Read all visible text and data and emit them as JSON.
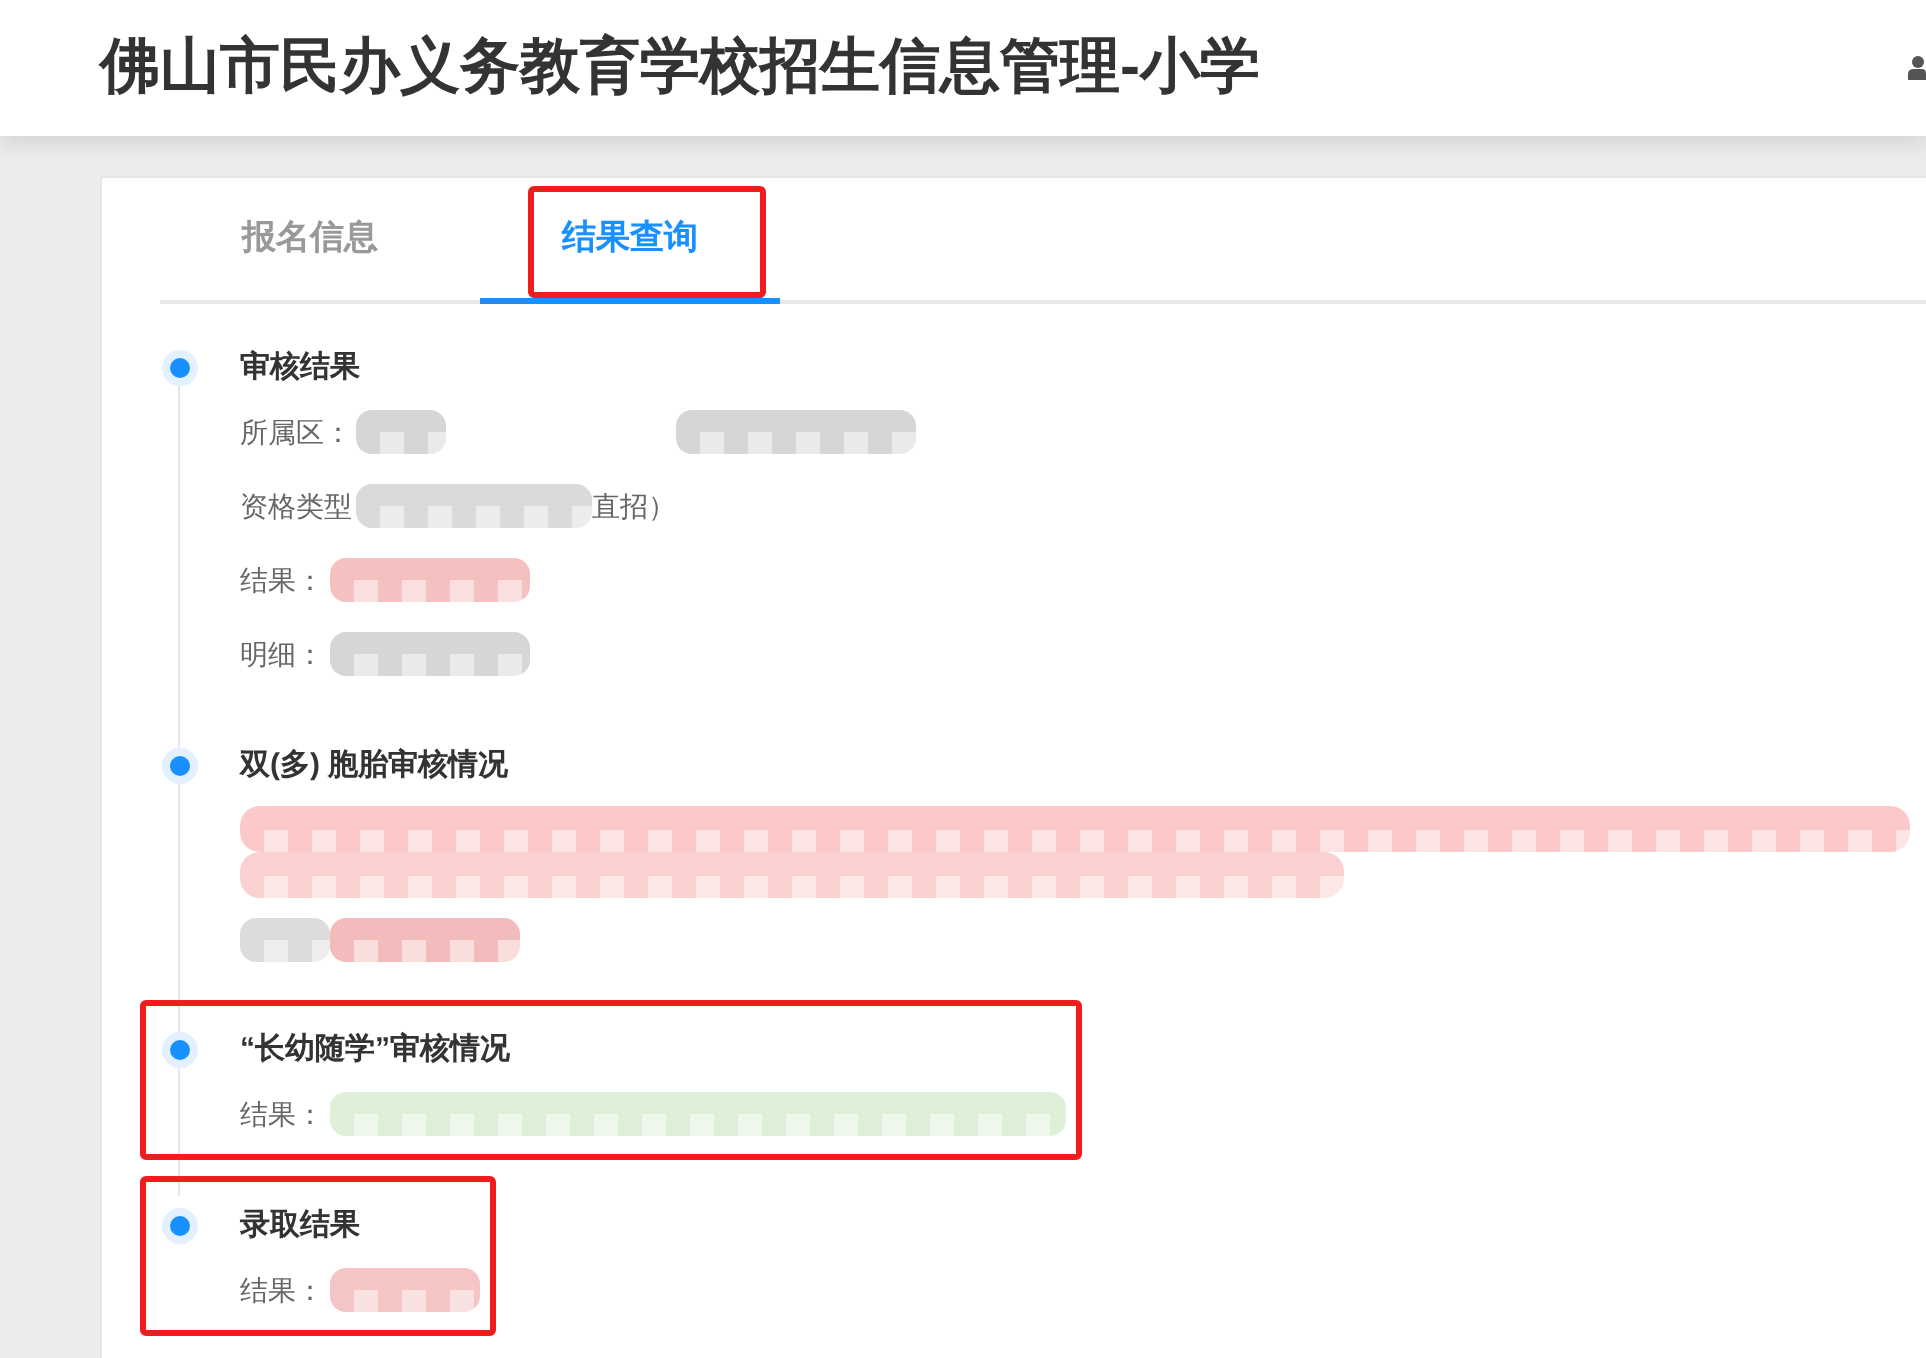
{
  "header": {
    "title": "佛山市民办义务教育学校招生信息管理-小学"
  },
  "tabs": [
    {
      "label": "报名信息",
      "selected": false,
      "highlighted": false
    },
    {
      "label": "结果查询",
      "selected": true,
      "highlighted": true
    }
  ],
  "timeline": [
    {
      "title": "审核结果",
      "highlighted": false,
      "details": [
        {
          "kind": "field",
          "label": "所属区：",
          "redactions": [
            {
              "color": "#d6d5d7"
            },
            {
              "color": "#d6d5d7"
            }
          ]
        },
        {
          "kind": "field",
          "label": "资格类型",
          "redactions": [
            {
              "color": "#dadadc"
            }
          ],
          "suffix": "直招）"
        },
        {
          "kind": "field",
          "label": "结果：",
          "redactions": [
            {
              "color": "#f4c0c0"
            }
          ]
        },
        {
          "kind": "field",
          "label": "明细：",
          "redactions": [
            {
              "color": "#d6d6d8"
            }
          ]
        }
      ]
    },
    {
      "title": "双(多) 胞胎审核情况",
      "highlighted": false,
      "details": [
        {
          "kind": "paragraph",
          "redactions": [
            {
              "color": "#fbc9c9"
            },
            {
              "color": "#fbd0d0"
            }
          ]
        },
        {
          "kind": "field",
          "redactions": [
            {
              "color": "#dcdcdc"
            },
            {
              "color": "#f3bcbc"
            }
          ]
        }
      ]
    },
    {
      "title": "“长幼随学”审核情况",
      "highlighted": true,
      "details": [
        {
          "kind": "field",
          "label": "结果：",
          "redactions": [
            {
              "color": "#dff0d8"
            }
          ]
        }
      ]
    },
    {
      "title": "录取结果",
      "highlighted": true,
      "details": [
        {
          "kind": "field",
          "label": "结果：",
          "redactions": [
            {
              "color": "#f5c4c4"
            }
          ]
        }
      ]
    }
  ]
}
